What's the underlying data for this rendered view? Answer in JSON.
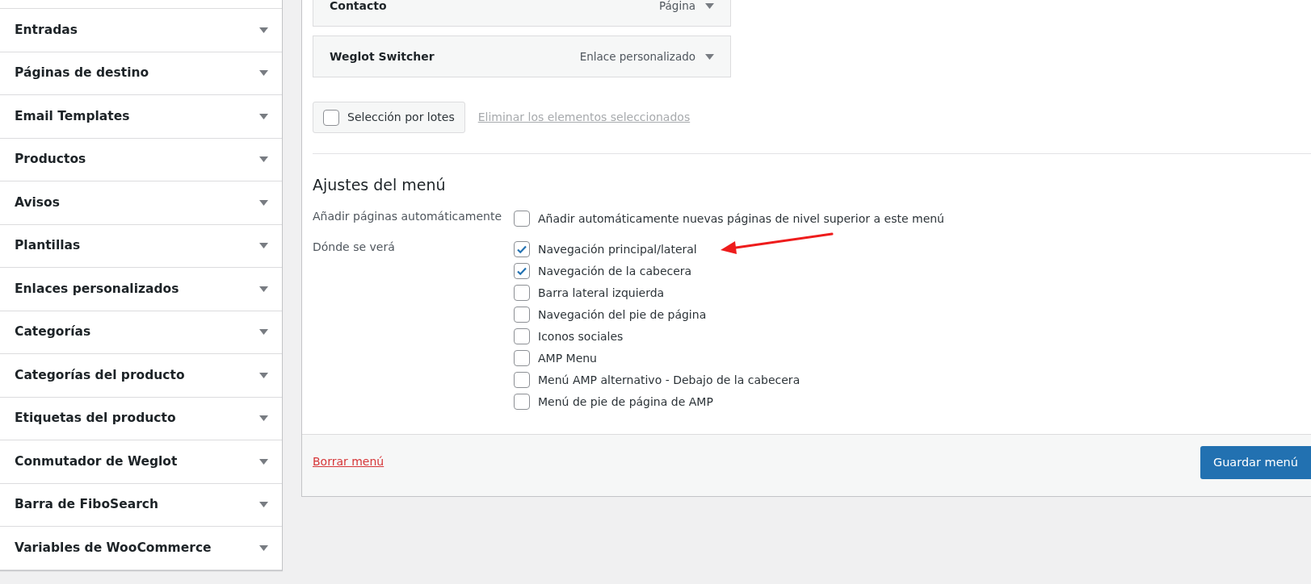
{
  "sidebar": {
    "items": [
      {
        "label": "Entradas"
      },
      {
        "label": "Páginas de destino"
      },
      {
        "label": "Email Templates"
      },
      {
        "label": "Productos"
      },
      {
        "label": "Avisos"
      },
      {
        "label": "Plantillas"
      },
      {
        "label": "Enlaces personalizados"
      },
      {
        "label": "Categorías"
      },
      {
        "label": "Categorías del producto"
      },
      {
        "label": "Etiquetas del producto"
      },
      {
        "label": "Conmutador de Weglot"
      },
      {
        "label": "Barra de FiboSearch"
      },
      {
        "label": "Variables de WooCommerce"
      }
    ]
  },
  "menu_items": [
    {
      "title": "Contacto",
      "type": "Página"
    },
    {
      "title": "Weglot Switcher",
      "type": "Enlace personalizado"
    }
  ],
  "bulk_select": {
    "label": "Selección por lotes",
    "checked": false
  },
  "delete_selected_link": "Eliminar los elementos seleccionados",
  "settings": {
    "heading": "Ajustes del menú",
    "groups": [
      {
        "label": "Añadir páginas automáticamente",
        "options": [
          {
            "label": "Añadir automáticamente nuevas páginas de nivel superior a este menú",
            "checked": false
          }
        ]
      },
      {
        "label": "Dónde se verá",
        "options": [
          {
            "label": "Navegación principal/lateral",
            "checked": true
          },
          {
            "label": "Navegación de la cabecera",
            "checked": true
          },
          {
            "label": "Barra lateral izquierda",
            "checked": false
          },
          {
            "label": "Navegación del pie de página",
            "checked": false
          },
          {
            "label": "Iconos sociales",
            "checked": false
          },
          {
            "label": "AMP Menu",
            "checked": false
          },
          {
            "label": "Menú AMP alternativo - Debajo de la cabecera",
            "checked": false
          },
          {
            "label": "Menú de pie de página de AMP",
            "checked": false
          }
        ]
      }
    ]
  },
  "footer": {
    "delete_link": "Borrar menú",
    "save_button": "Guardar menú"
  }
}
